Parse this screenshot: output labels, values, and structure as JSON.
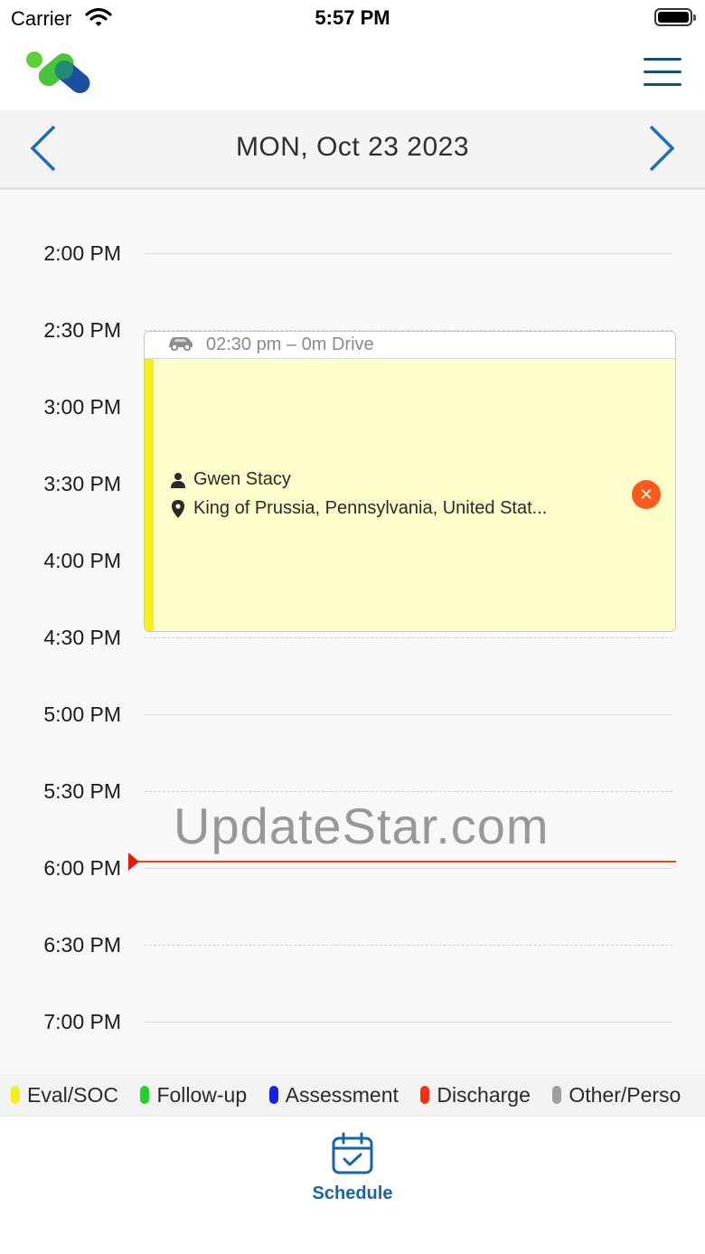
{
  "status_bar": {
    "carrier": "Carrier",
    "time": "5:57 PM"
  },
  "header": {
    "logo_icon": "app-logo",
    "menu_icon": "hamburger-menu-icon"
  },
  "date_nav": {
    "title": "MON, Oct 23 2023",
    "prev_icon": "chevron-left-icon",
    "next_icon": "chevron-right-icon"
  },
  "schedule": {
    "times": [
      "2:00 PM",
      "2:30 PM",
      "3:00 PM",
      "3:30 PM",
      "4:00 PM",
      "4:30 PM",
      "5:00 PM",
      "5:30 PM",
      "6:00 PM",
      "6:30 PM",
      "7:00 PM"
    ],
    "appointment": {
      "drive_text": "02:30 pm – 0m Drive",
      "patient": "Gwen Stacy",
      "location": "King of Prussia, Pennsylvania, United Stat...",
      "type_color": "#f4f01e"
    },
    "current_time_color": "#f2450f"
  },
  "watermark": "UpdateStar.com",
  "legend": [
    {
      "label": "Eval/SOC",
      "color": "#f4f01e"
    },
    {
      "label": "Follow-up",
      "color": "#22d12c"
    },
    {
      "label": "Assessment",
      "color": "#1722e0"
    },
    {
      "label": "Discharge",
      "color": "#f2330f"
    },
    {
      "label": "Other/Perso",
      "color": "#9e9e9e"
    }
  ],
  "tab_bar": {
    "schedule_label": "Schedule",
    "schedule_icon": "calendar-check-icon",
    "accent": "#1565a8"
  }
}
